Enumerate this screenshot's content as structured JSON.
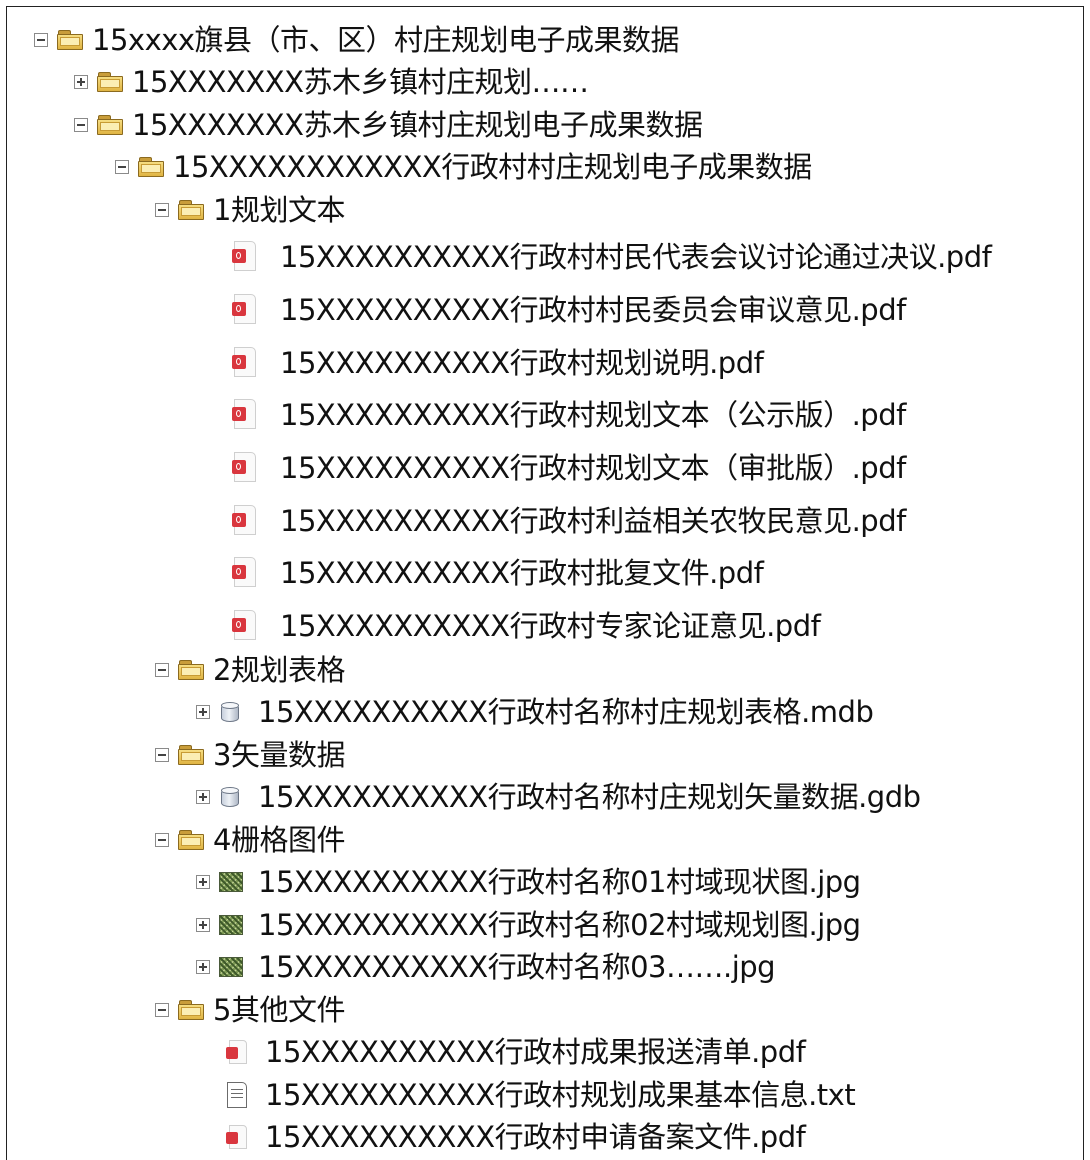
{
  "tree": {
    "root": {
      "label": "15xxxx旗县（市、区）村庄规划电子成果数据",
      "state": "expanded",
      "icon": "folder-icon"
    },
    "township_collapsed": {
      "label": "15XXXXXXX苏木乡镇村庄规划……",
      "state": "collapsed",
      "icon": "folder-icon"
    },
    "township": {
      "label": "15XXXXXXX苏木乡镇村庄规划电子成果数据",
      "state": "expanded",
      "icon": "folder-icon"
    },
    "village": {
      "label": "15XXXXXXXXXXXX行政村村庄规划电子成果数据",
      "state": "expanded",
      "icon": "folder-icon"
    },
    "folders": [
      {
        "label": "1规划文本",
        "state": "expanded",
        "icon": "folder-icon",
        "files": [
          {
            "label": "15XXXXXXXXXX行政村村民代表会议讨论通过决议.pdf",
            "icon": "pdf-icon"
          },
          {
            "label": "15XXXXXXXXXX行政村村民委员会审议意见.pdf",
            "icon": "pdf-icon"
          },
          {
            "label": "15XXXXXXXXXX行政村规划说明.pdf",
            "icon": "pdf-icon"
          },
          {
            "label": "15XXXXXXXXXX行政村规划文本（公示版）.pdf",
            "icon": "pdf-icon"
          },
          {
            "label": "15XXXXXXXXXX行政村规划文本（审批版）.pdf",
            "icon": "pdf-icon"
          },
          {
            "label": "15XXXXXXXXXX行政村利益相关农牧民意见.pdf",
            "icon": "pdf-icon"
          },
          {
            "label": "15XXXXXXXXXX行政村批复文件.pdf",
            "icon": "pdf-icon"
          },
          {
            "label": "15XXXXXXXXXX行政村专家论证意见.pdf",
            "icon": "pdf-icon"
          }
        ]
      },
      {
        "label": "2规划表格",
        "state": "expanded",
        "icon": "folder-icon",
        "files": [
          {
            "label": "15XXXXXXXXXX行政村名称村庄规划表格.mdb",
            "icon": "database-icon",
            "state": "collapsed"
          }
        ]
      },
      {
        "label": "3矢量数据",
        "state": "expanded",
        "icon": "folder-icon",
        "files": [
          {
            "label": "15XXXXXXXXXX行政村名称村庄规划矢量数据.gdb",
            "icon": "database-icon",
            "state": "collapsed"
          }
        ]
      },
      {
        "label": "4栅格图件",
        "state": "expanded",
        "icon": "folder-icon",
        "files": [
          {
            "label": "15XXXXXXXXXX行政村名称01村域现状图.jpg",
            "icon": "raster-icon",
            "state": "collapsed"
          },
          {
            "label": "15XXXXXXXXXX行政村名称02村域规划图.jpg",
            "icon": "raster-icon",
            "state": "collapsed"
          },
          {
            "label": "15XXXXXXXXXX行政村名称03…….jpg",
            "icon": "raster-icon",
            "state": "collapsed"
          }
        ]
      },
      {
        "label": "5其他文件",
        "state": "expanded",
        "icon": "folder-icon",
        "files": [
          {
            "label": "15XXXXXXXXXX行政村成果报送清单.pdf",
            "icon": "pdf-icon"
          },
          {
            "label": "15XXXXXXXXXX行政村规划成果基本信息.txt",
            "icon": "text-file-icon"
          },
          {
            "label": "15XXXXXXXXXX行政村申请备案文件.pdf",
            "icon": "pdf-icon"
          }
        ]
      }
    ]
  }
}
